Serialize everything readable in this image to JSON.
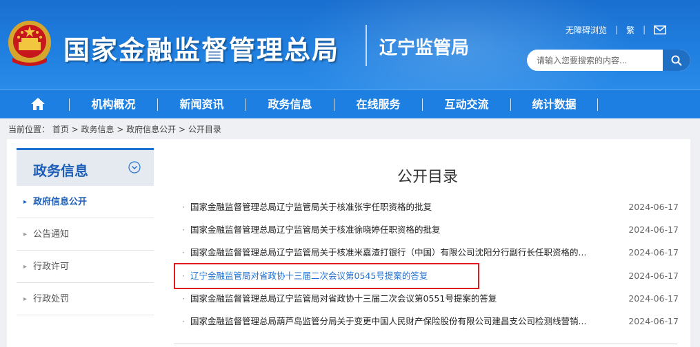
{
  "header": {
    "site_title": "国家金融监督管理总局",
    "branch_title": "辽宁监管局",
    "links": [
      "无障碍浏览",
      "繁"
    ],
    "search_placeholder": "请输入您要搜索的内容..."
  },
  "nav": {
    "items": [
      "机构概况",
      "新闻资讯",
      "政务信息",
      "在线服务",
      "互动交流",
      "统计数据"
    ]
  },
  "breadcrumb": "当前位置：  首页 > 政务信息 > 政府信息公开 > 公开目录",
  "sidebar": {
    "title": "政务信息",
    "items": [
      {
        "label": "政府信息公开",
        "active": true
      },
      {
        "label": "公告通知",
        "active": false
      },
      {
        "label": "行政许可",
        "active": false
      },
      {
        "label": "行政处罚",
        "active": false
      }
    ]
  },
  "main": {
    "title": "公开目录",
    "documents": [
      {
        "title": "国家金融监督管理总局辽宁监管局关于核准张宇任职资格的批复",
        "date": "2024-06-17",
        "highlighted": false
      },
      {
        "title": "国家金融监督管理总局辽宁监管局关于核准徐晓婷任职资格的批复",
        "date": "2024-06-17",
        "highlighted": false
      },
      {
        "title": "国家金融监督管理总局辽宁监管局关于核准米嘉渣打银行（中国）有限公司沈阳分行副行长任职资格的...",
        "date": "2024-06-17",
        "highlighted": false
      },
      {
        "title": "辽宁金融监管局对省政协十三届二次会议第0545号提案的答复",
        "date": "2024-06-17",
        "highlighted": true
      },
      {
        "title": "国家金融监督管理总局辽宁监管局对省政协十三届二次会议第0551号提案的答复",
        "date": "2024-06-17",
        "highlighted": false
      },
      {
        "title": "国家金融监督管理总局葫芦岛监管分局关于变更中国人民财产保险股份有限公司建昌支公司检测线营销...",
        "date": "2024-06-17",
        "highlighted": false
      }
    ]
  },
  "colors": {
    "header_blue": "#1f7fe0",
    "nav_blue": "#1d7fe1",
    "link_blue": "#1d6fd0",
    "highlight_red": "#e0191d"
  },
  "icons": [
    "national-emblem-icon",
    "mail-icon",
    "search-icon",
    "home-icon",
    "chevron-down-icon"
  ]
}
